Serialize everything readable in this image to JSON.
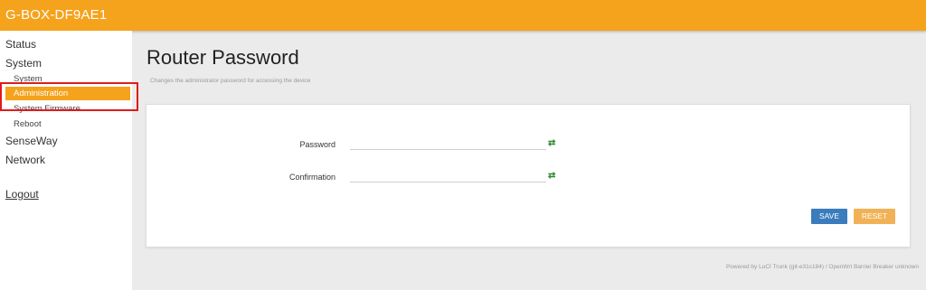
{
  "header": {
    "brand": "G-BOX-DF9AE1"
  },
  "sidebar": {
    "items": [
      {
        "label": "Status"
      },
      {
        "label": "System"
      },
      {
        "label": "System"
      },
      {
        "label": "Administration"
      },
      {
        "label": "System Firmware"
      },
      {
        "label": "Reboot"
      },
      {
        "label": "SenseWay"
      },
      {
        "label": "Network"
      }
    ],
    "logout": "Logout",
    "active_item": "Administration"
  },
  "main": {
    "title": "Router Password",
    "description": "Changes the administrator password for accessing the device",
    "fields": [
      {
        "label": "Password",
        "value": "",
        "icon": "reveal-password-icon"
      },
      {
        "label": "Confirmation",
        "value": "",
        "icon": "reveal-password-icon"
      }
    ],
    "icon_glyph": "⇄",
    "buttons": {
      "save": "SAVE",
      "reset": "RESET"
    }
  },
  "footer": {
    "text": "Powered by LuCI Trunk (git-e31c184) / OpenWrt Barrier Breaker unknown"
  },
  "colors": {
    "accent": "#f5a21c",
    "save": "#3a7cbc",
    "reset": "#f1b257",
    "highlight": "#e11b1b"
  }
}
